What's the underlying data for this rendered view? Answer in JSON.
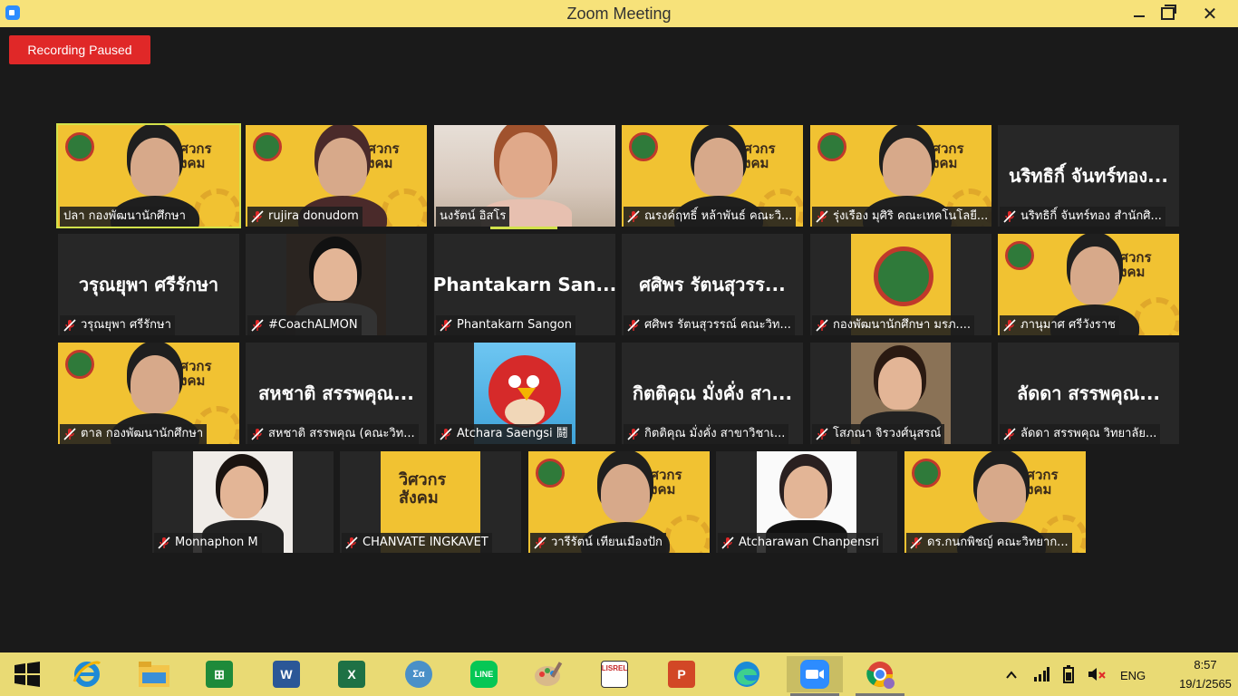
{
  "window": {
    "title": "Zoom Meeting"
  },
  "recording": {
    "label": "Recording Paused"
  },
  "participants": [
    {
      "name": "ปลา กองพัฒนานักศึกษา",
      "muted": false,
      "active": true,
      "video": "banner-person"
    },
    {
      "name": "rujira donudom",
      "muted": true,
      "video": "banner-person"
    },
    {
      "name": "นงรัตน์ อิสโร",
      "muted": false,
      "video": "room-person"
    },
    {
      "name": "ณรงค์ฤทธิ์ หล้าพันธ์ คณะวิ...",
      "muted": true,
      "video": "banner-person"
    },
    {
      "name": "รุ่งเรือง มุศิริ คณะเทคโนโลยี...",
      "muted": true,
      "video": "banner-person"
    },
    {
      "name": "นริทธิกิ์ จันทร์ทอง สำนักศิ...",
      "muted": true,
      "video": "none",
      "display_name": "นริทธิกิ์ จันทร์ทอง..."
    },
    {
      "name": "วรุณยุพา ศรีรักษา",
      "muted": true,
      "video": "none",
      "display_name": "วรุณยุพา ศรีรักษา"
    },
    {
      "name": "#CoachALMON",
      "muted": true,
      "video": "portrait"
    },
    {
      "name": "Phantakarn Sangon",
      "muted": true,
      "video": "none",
      "display_name": "Phantakarn San..."
    },
    {
      "name": "ศศิพร รัตนสุวรรณ์ คณะวิท...",
      "muted": true,
      "video": "none",
      "display_name": "ศศิพร รัตนสุวรร..."
    },
    {
      "name": "กองพัฒนานักศึกษา มรภ....",
      "muted": true,
      "video": "logo-banner"
    },
    {
      "name": "ภานุมาศ ศรีวังราช",
      "muted": true,
      "video": "banner-person"
    },
    {
      "name": "ตาล กองพัฒนานักศึกษา",
      "muted": true,
      "video": "banner-person"
    },
    {
      "name": "สหชาติ สรรพคุณ (คณะวิท...",
      "muted": true,
      "video": "none",
      "display_name": "สหชาติ สรรพคุณ..."
    },
    {
      "name": "Atchara Saengsi 鬪",
      "muted": true,
      "video": "red-bird"
    },
    {
      "name": "กิตติคุณ มั่งคั่ง สาขาวิชาเ...",
      "muted": true,
      "video": "none",
      "display_name": "กิตติคุณ มั่งคั่ง สา..."
    },
    {
      "name": "โสภณา จิรวงศ์นุสรณ์",
      "muted": true,
      "video": "portrait"
    },
    {
      "name": "ลัดดา สรรพคุณ วิทยาลัย...",
      "muted": true,
      "video": "none",
      "display_name": "ลัดดา สรรพคุณ..."
    },
    {
      "name": "Monnaphon M",
      "muted": true,
      "video": "portrait"
    },
    {
      "name": "CHANVATE INGKAVET",
      "muted": true,
      "video": "banner-text"
    },
    {
      "name": "วารีรัตน์ เทียนเมืองปัก",
      "muted": true,
      "video": "banner-person"
    },
    {
      "name": "Atcharawan Chanpensri",
      "muted": true,
      "video": "portrait"
    },
    {
      "name": "ดร.กนกพิชญ์ คณะวิทยาก...",
      "muted": true,
      "video": "banner-person"
    }
  ],
  "banner_text": {
    "line1": "วิศวกร",
    "line2": "สังคม"
  },
  "taskbar": {
    "apps": [
      "start-icon",
      "internet-explorer-icon",
      "file-explorer-icon",
      "store-icon",
      "word-icon",
      "excel-icon",
      "math-input-icon",
      "line-icon",
      "paint-icon",
      "lisrel-icon",
      "powerpoint-icon",
      "edge-icon",
      "zoom-icon",
      "chrome-icon"
    ],
    "app_labels": {
      "word": "W",
      "excel": "X",
      "powerpoint": "P",
      "line": "LINE",
      "lisrel": "LISREL",
      "math": "Σα"
    },
    "language": "ENG",
    "time": "8:57",
    "date": "19/1/2565"
  },
  "colors": {
    "accent": "#d2e24b",
    "recording": "#e02828",
    "titlebar": "#f7e27a",
    "banner": "#f1c232"
  }
}
